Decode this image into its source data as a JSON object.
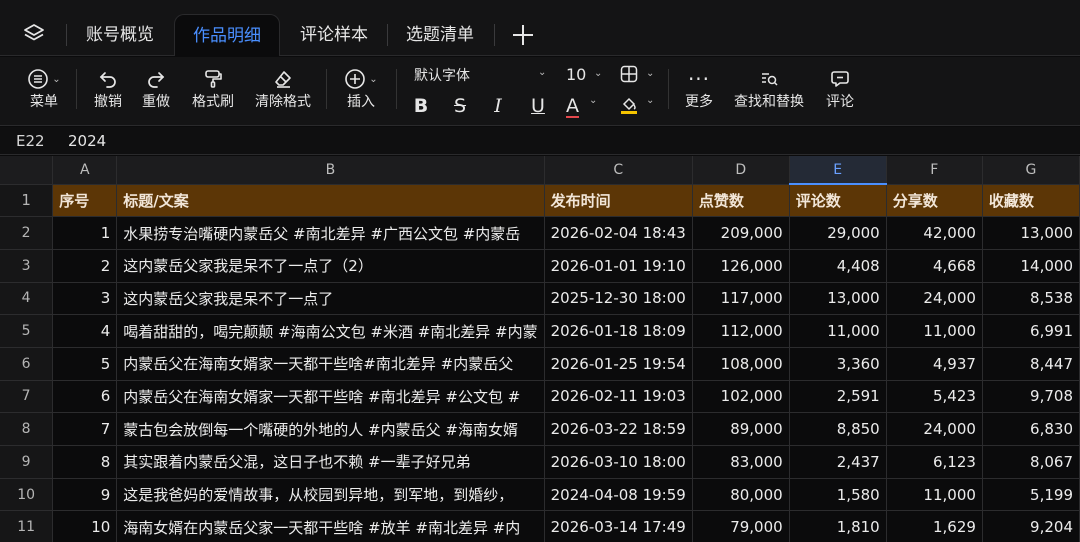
{
  "tabs": [
    {
      "label": "账号概览",
      "active": false
    },
    {
      "label": "作品明细",
      "active": true
    },
    {
      "label": "评论样本",
      "active": false
    },
    {
      "label": "选题清单",
      "active": false
    }
  ],
  "toolbar": {
    "menu": "菜单",
    "undo": "撤销",
    "redo": "重做",
    "format_painter": "格式刷",
    "clear_format": "清除格式",
    "insert": "插入",
    "font": "默认字体",
    "font_size": "10",
    "more": "更多",
    "find_replace": "查找和替换",
    "comment": "评论"
  },
  "formula_bar": {
    "cell": "E22",
    "value": "2024"
  },
  "columns": [
    "A",
    "B",
    "C",
    "D",
    "E",
    "F",
    "G"
  ],
  "selected_column": "E",
  "header_row": {
    "row_number": "1",
    "cells": [
      "序号",
      "标题/文案",
      "发布时间",
      "点赞数",
      "评论数",
      "分享数",
      "收藏数"
    ]
  },
  "rows": [
    {
      "n": "2",
      "cells": [
        "1",
        "水果捞专治嘴硬内蒙岳父 #南北差异 #广西公文包 #内蒙岳",
        "2026-02-04 18:43",
        "209,000",
        "29,000",
        "42,000",
        "13,000"
      ]
    },
    {
      "n": "3",
      "cells": [
        "2",
        "这内蒙岳父家我是呆不了一点了（2）",
        "2026-01-01 19:10",
        "126,000",
        "4,408",
        "4,668",
        "14,000"
      ]
    },
    {
      "n": "4",
      "cells": [
        "3",
        "这内蒙岳父家我是呆不了一点了",
        "2025-12-30 18:00",
        "117,000",
        "13,000",
        "24,000",
        "8,538"
      ]
    },
    {
      "n": "5",
      "cells": [
        "4",
        "喝着甜甜的，喝完颠颠 #海南公文包 #米酒 #南北差异 #内蒙",
        "2026-01-18 18:09",
        "112,000",
        "11,000",
        "11,000",
        "6,991"
      ]
    },
    {
      "n": "6",
      "cells": [
        "5",
        "内蒙岳父在海南女婿家一天都干些啥#南北差异 #内蒙岳父",
        "2026-01-25 19:54",
        "108,000",
        "3,360",
        "4,937",
        "8,447"
      ]
    },
    {
      "n": "7",
      "cells": [
        "6",
        "内蒙岳父在海南女婿家一天都干些啥 #南北差异 #公文包 #",
        "2026-02-11 19:03",
        "102,000",
        "2,591",
        "5,423",
        "9,708"
      ]
    },
    {
      "n": "8",
      "cells": [
        "7",
        "蒙古包会放倒每一个嘴硬的外地的人 #内蒙岳父 #海南女婿",
        "2026-03-22 18:59",
        "89,000",
        "8,850",
        "24,000",
        "6,830"
      ]
    },
    {
      "n": "9",
      "cells": [
        "8",
        "其实跟着内蒙岳父混，这日子也不赖 #一辈子好兄弟",
        "2026-03-10 18:00",
        "83,000",
        "2,437",
        "6,123",
        "8,067"
      ]
    },
    {
      "n": "10",
      "cells": [
        "9",
        "这是我爸妈的爱情故事，从校园到异地，到军地，到婚纱，",
        "2024-04-08 19:59",
        "80,000",
        "1,580",
        "11,000",
        "5,199"
      ]
    },
    {
      "n": "11",
      "cells": [
        "10",
        "海南女婿在内蒙岳父家一天都干些啥 #放羊 #南北差异 #内",
        "2026-03-14 17:49",
        "79,000",
        "1,810",
        "1,629",
        "9,204"
      ]
    }
  ],
  "colors": {
    "accent": "#4a8fff",
    "header_fill": "#5c3606",
    "underline_red": "#e5484d",
    "highlight_yellow": "#f5c400"
  }
}
